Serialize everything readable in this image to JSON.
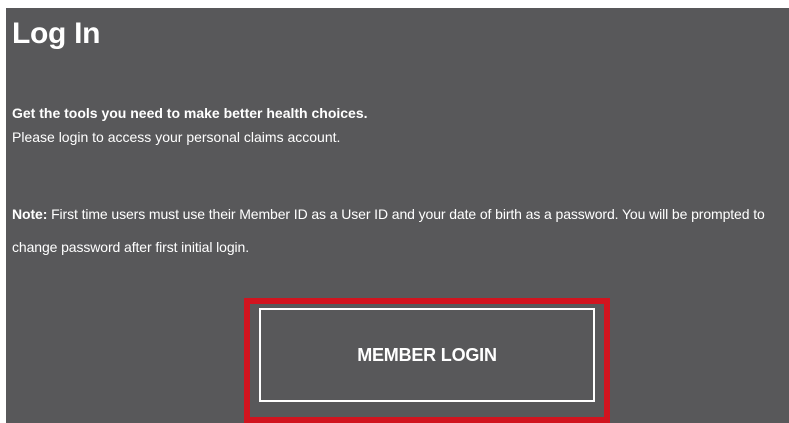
{
  "login": {
    "title": "Log In",
    "tagline": "Get the tools you need to make better health choices.",
    "subtitle": "Please login to access your personal claims account.",
    "note_label": "Note:",
    "note_text": " First time users must use their Member ID as a User ID and your date of birth as a password. You will be prompted to change password after first initial login.",
    "button_label": "MEMBER LOGIN"
  },
  "colors": {
    "panel_background": "#58585a",
    "text": "#ffffff",
    "highlight_border": "#d1141f"
  }
}
